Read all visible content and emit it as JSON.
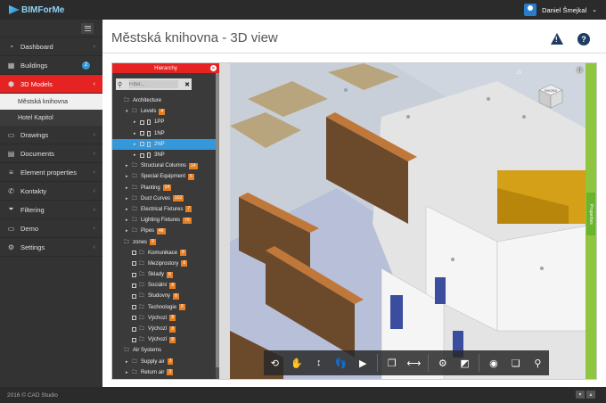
{
  "topbar": {
    "brand": "BIMForMe",
    "user_name": "Daniel Šmejkal"
  },
  "sidebar": {
    "items": [
      {
        "label": "Dashboard",
        "icon": "gauge-icon"
      },
      {
        "label": "Buildings",
        "icon": "building-icon",
        "badge": "2"
      },
      {
        "label": "3D Models",
        "icon": "cube-icon",
        "active": true
      },
      {
        "label": "Drawings",
        "icon": "drawings-icon"
      },
      {
        "label": "Documents",
        "icon": "documents-icon"
      },
      {
        "label": "Element properties",
        "icon": "list-icon"
      },
      {
        "label": "Kontakty",
        "icon": "phone-icon"
      },
      {
        "label": "Filtering",
        "icon": "filter-icon"
      },
      {
        "label": "Demo",
        "icon": "demo-icon"
      },
      {
        "label": "Settings",
        "icon": "gear-icon"
      }
    ],
    "subitems": [
      "Městská knihovna",
      "Hotel Kapitol"
    ]
  },
  "page": {
    "title": "Městská knihovna - 3D view"
  },
  "hierarchy": {
    "title": "Hierarchy",
    "search_placeholder": "Filter...",
    "rows": [
      {
        "label": "Architecture",
        "indent": 0,
        "arrow": "",
        "type": "folder"
      },
      {
        "label": "Levels",
        "indent": 1,
        "arrow": "▾",
        "type": "folder",
        "count": "4"
      },
      {
        "label": "1PP",
        "indent": 2,
        "arrow": "▸",
        "type": "doc"
      },
      {
        "label": "1NP",
        "indent": 2,
        "arrow": "▸",
        "type": "doc"
      },
      {
        "label": "2NP",
        "indent": 2,
        "arrow": "▸",
        "type": "doc",
        "selected": true
      },
      {
        "label": "3NP",
        "indent": 2,
        "arrow": "▸",
        "type": "doc"
      },
      {
        "label": "Structural Columns",
        "indent": 1,
        "arrow": "▸",
        "type": "folder",
        "count": "14"
      },
      {
        "label": "Special Equipment",
        "indent": 1,
        "arrow": "▸",
        "type": "folder",
        "count": "5"
      },
      {
        "label": "Planting",
        "indent": 1,
        "arrow": "▸",
        "type": "folder",
        "count": "24"
      },
      {
        "label": "Duct Curves",
        "indent": 1,
        "arrow": "▸",
        "type": "folder",
        "count": "102"
      },
      {
        "label": "Electrical Fixtures",
        "indent": 1,
        "arrow": "▸",
        "type": "folder",
        "count": "7"
      },
      {
        "label": "Lighting Fixtures",
        "indent": 1,
        "arrow": "▸",
        "type": "folder",
        "count": "79"
      },
      {
        "label": "Pipes",
        "indent": 1,
        "arrow": "▸",
        "type": "folder",
        "count": "48"
      },
      {
        "label": "zones",
        "indent": 0,
        "arrow": "",
        "type": "folder",
        "count": "9"
      },
      {
        "label": "Komunikace",
        "indent": 1,
        "arrow": "",
        "type": "chkfolder",
        "count": "8"
      },
      {
        "label": "Meziprostory",
        "indent": 1,
        "arrow": "",
        "type": "chkfolder",
        "count": "8"
      },
      {
        "label": "Sklady",
        "indent": 1,
        "arrow": "",
        "type": "chkfolder",
        "count": "8"
      },
      {
        "label": "Sociální",
        "indent": 1,
        "arrow": "",
        "type": "chkfolder",
        "count": "8"
      },
      {
        "label": "Studovny",
        "indent": 1,
        "arrow": "",
        "type": "chkfolder",
        "count": "8"
      },
      {
        "label": "Technologie",
        "indent": 1,
        "arrow": "",
        "type": "chkfolder",
        "count": "8"
      },
      {
        "label": "Výchozí",
        "indent": 1,
        "arrow": "",
        "type": "chkfolder",
        "count": "8"
      },
      {
        "label": "Výchozí",
        "indent": 1,
        "arrow": "",
        "type": "chkfolder",
        "count": "8"
      },
      {
        "label": "Výchozí",
        "indent": 1,
        "arrow": "",
        "type": "chkfolder",
        "count": "8"
      },
      {
        "label": "Air Systems",
        "indent": 0,
        "arrow": "",
        "type": "folder"
      },
      {
        "label": "Supply air",
        "indent": 1,
        "arrow": "▸",
        "type": "folder",
        "count": "3"
      },
      {
        "label": "Return air",
        "indent": 1,
        "arrow": "▸",
        "type": "folder",
        "count": "3"
      }
    ]
  },
  "viewer": {
    "properties_tab": "Properties",
    "viewcube_label": "SHORA",
    "toolbar": [
      "orbit-icon",
      "pan-icon",
      "zoom-icon",
      "walk-icon",
      "camera-icon",
      "explode-icon",
      "measure-icon",
      "settings-icon",
      "fullscreen-icon",
      "visibility-icon",
      "layers-icon",
      "inspect-icon"
    ]
  },
  "footer": {
    "text": "2016 © CAD Studio"
  }
}
